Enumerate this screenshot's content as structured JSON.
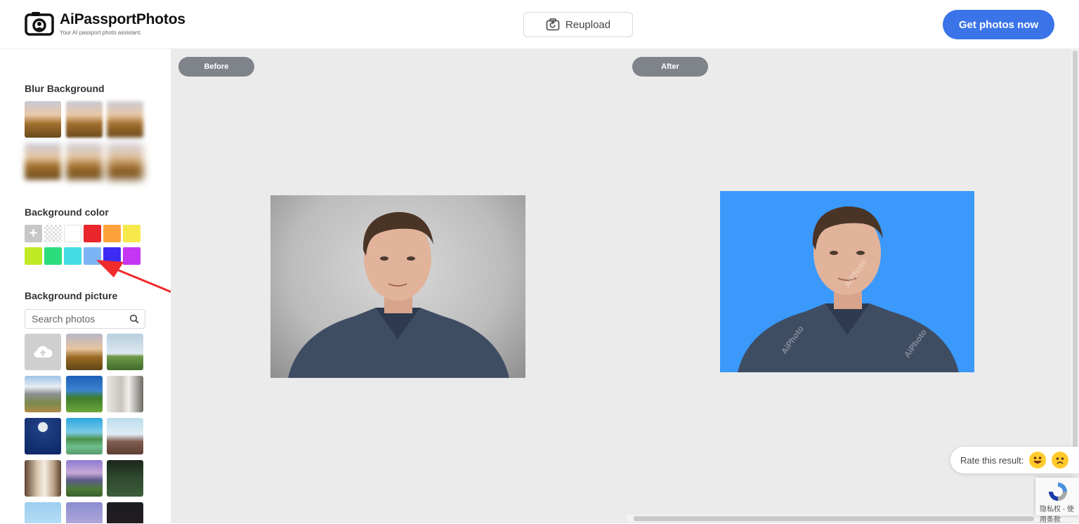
{
  "header": {
    "logo_title": "AiPassportPhotos",
    "logo_subtitle": "Your AI passport photo assistant.",
    "reupload_label": "Reupload",
    "get_photos_label": "Get photos now"
  },
  "sidebar": {
    "blur_title": "Blur Background",
    "color_title": "Background color",
    "picture_title": "Background picture",
    "plus_label": "+",
    "search_placeholder": "Search photos",
    "colors": [
      "#e8262b",
      "#ffa23c",
      "#f7e94b",
      "#c0ea25",
      "#2cdd7d",
      "#44dce3",
      "#7db4f6",
      "#3c2cf2",
      "#c435f4"
    ],
    "selected_color": "#7db4f6"
  },
  "main": {
    "before_label": "Before",
    "after_label": "After",
    "after_background": "#3a99fb",
    "watermark": "AiPhoto"
  },
  "rate": {
    "label": "Rate this result:"
  },
  "recaptcha": {
    "text": "隐私权 - 使用条款"
  }
}
